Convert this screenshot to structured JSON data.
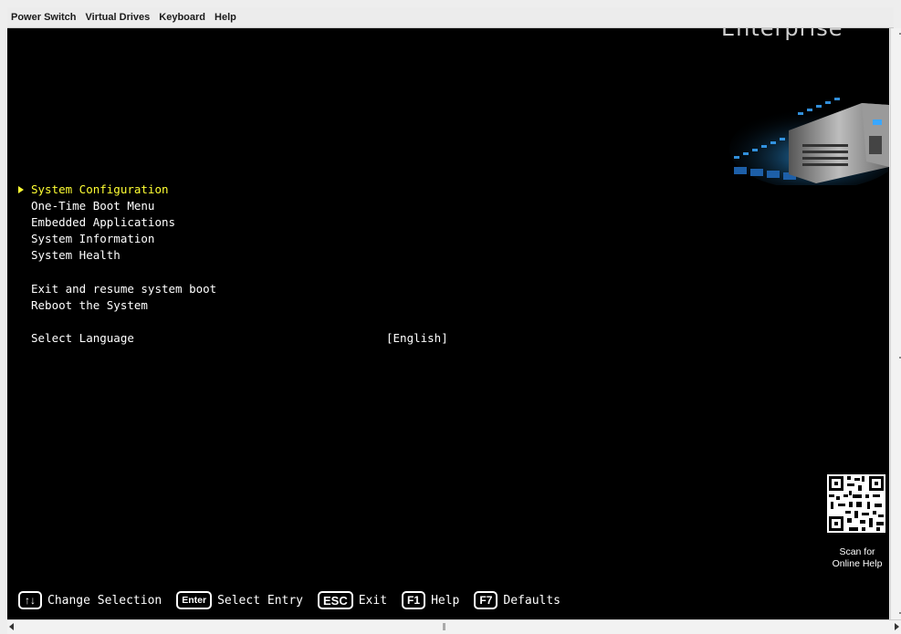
{
  "menubar": {
    "items": [
      "Power Switch",
      "Virtual Drives",
      "Keyboard",
      "Help"
    ]
  },
  "console": {
    "brand_text": "Enterprise",
    "menu": {
      "items": [
        {
          "label": "System Configuration",
          "selected": true
        },
        {
          "label": "One-Time Boot Menu",
          "selected": false
        },
        {
          "label": "Embedded Applications",
          "selected": false
        },
        {
          "label": "System Information",
          "selected": false
        },
        {
          "label": "System Health",
          "selected": false
        },
        {
          "label": "Exit and resume system boot",
          "selected": false
        },
        {
          "label": "Reboot the System",
          "selected": false
        },
        {
          "label": "Select Language",
          "selected": false
        }
      ],
      "language_value": "[English]"
    },
    "qr": {
      "caption_line1": "Scan for",
      "caption_line2": "Online Help"
    },
    "footer": {
      "keys": [
        {
          "key": "↑↓",
          "label": "Change Selection"
        },
        {
          "key": "Enter",
          "label": "Select Entry"
        },
        {
          "key": "ESC",
          "label": "Exit"
        },
        {
          "key": "F1",
          "label": "Help"
        },
        {
          "key": "F7",
          "label": "Defaults"
        }
      ]
    }
  },
  "colors": {
    "console_bg": "#000000",
    "selected_text": "#ffff33",
    "normal_text": "#ffffff",
    "menubar_bg": "#ececec"
  }
}
